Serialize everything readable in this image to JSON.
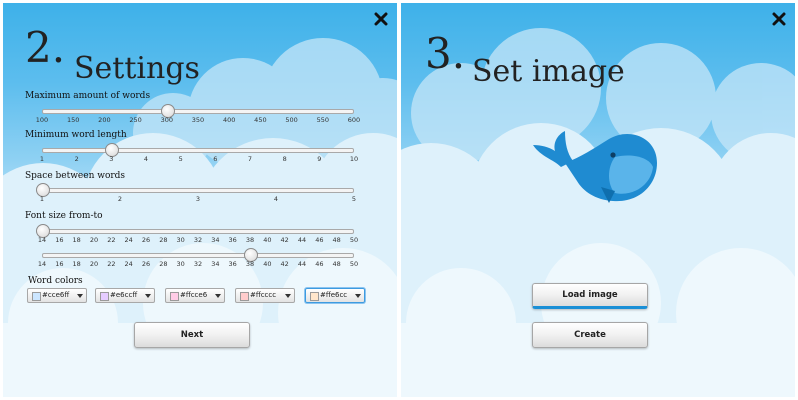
{
  "settings_panel": {
    "step_number": "2.",
    "title": "Settings",
    "max_words": {
      "label": "Maximum amount of words",
      "ticks": [
        "100",
        "150",
        "200",
        "250",
        "300",
        "350",
        "400",
        "450",
        "500",
        "550",
        "600"
      ],
      "min": 100,
      "max": 600,
      "value": 300
    },
    "min_word_length": {
      "label": "Minimum word length",
      "ticks": [
        "1",
        "2",
        "3",
        "4",
        "5",
        "6",
        "7",
        "8",
        "9",
        "10"
      ],
      "min": 1,
      "max": 10,
      "value": 3
    },
    "space_between_words": {
      "label": "Space between words",
      "ticks": [
        "1",
        "2",
        "3",
        "4",
        "5"
      ],
      "min": 1,
      "max": 5,
      "value": 1
    },
    "font_size": {
      "label": "Font size from-to",
      "ticks": [
        "14",
        "16",
        "18",
        "20",
        "22",
        "24",
        "26",
        "28",
        "30",
        "32",
        "34",
        "36",
        "38",
        "40",
        "42",
        "44",
        "46",
        "48",
        "50"
      ],
      "min": 14,
      "max": 50,
      "from_value": 14,
      "to_value": 38
    },
    "word_colors": {
      "label": "Word colors",
      "items": [
        {
          "text": "#cce6ff",
          "color": "#cce6ff"
        },
        {
          "text": "#e6ccff",
          "color": "#e6ccff"
        },
        {
          "text": "#ffcce6",
          "color": "#ffcce6"
        },
        {
          "text": "#ffcccc",
          "color": "#ffcccc"
        },
        {
          "text": "#ffe6cc",
          "color": "#ffe6cc"
        }
      ]
    },
    "next_label": "Next"
  },
  "image_panel": {
    "step_number": "3.",
    "title": "Set image",
    "load_label": "Load image",
    "create_label": "Create"
  },
  "icons": {
    "close": "close-icon",
    "whale": "whale-icon"
  },
  "colors": {
    "sky": "#3eb1e9",
    "whale_body": "#1f8bd1",
    "whale_light": "#5ab4ea",
    "accent": "#1a8fd6"
  }
}
